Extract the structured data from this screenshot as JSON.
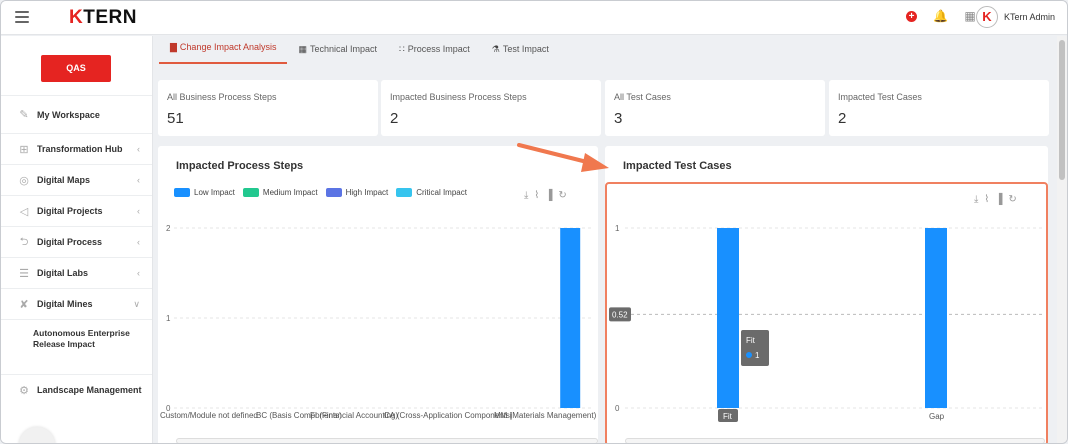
{
  "app": {
    "logo_k": "K",
    "logo_rest": "TERN",
    "user_name": "KTern Admin",
    "avatar_letter": "K"
  },
  "env": {
    "badge": "QAS"
  },
  "sidebar": {
    "items": [
      {
        "label": "My Workspace",
        "icon": "workspace-icon",
        "glyph": "✎",
        "has_chevron": false
      },
      {
        "label": "Transformation Hub",
        "icon": "grid-icon",
        "glyph": "⊞",
        "has_chevron": true
      },
      {
        "label": "Digital Maps",
        "icon": "map-icon",
        "glyph": "◎",
        "has_chevron": true
      },
      {
        "label": "Digital Projects",
        "icon": "projects-icon",
        "glyph": "◁",
        "has_chevron": true
      },
      {
        "label": "Digital Process",
        "icon": "process-icon",
        "glyph": "⮌",
        "has_chevron": true
      },
      {
        "label": "Digital Labs",
        "icon": "labs-icon",
        "glyph": "☰",
        "has_chevron": true
      },
      {
        "label": "Digital Mines",
        "icon": "mines-icon",
        "glyph": "✘",
        "has_chevron": true,
        "expanded": true
      }
    ],
    "sub_item": "Autonomous Enterprise Release Impact",
    "landscape": "Landscape Management"
  },
  "tabs": [
    {
      "label": "Change Impact Analysis",
      "icon": "chart-icon",
      "glyph": "▇",
      "active": true
    },
    {
      "label": "Technical Impact",
      "icon": "server-icon",
      "glyph": "▦",
      "active": false
    },
    {
      "label": "Process Impact",
      "icon": "process-flow-icon",
      "glyph": "∷",
      "active": false
    },
    {
      "label": "Test Impact",
      "icon": "flask-icon",
      "glyph": "⚗",
      "active": false
    }
  ],
  "cards": [
    {
      "label": "All Business Process Steps",
      "value": "51"
    },
    {
      "label": "Impacted Business Process Steps",
      "value": "2"
    },
    {
      "label": "All Test Cases",
      "value": "3"
    },
    {
      "label": "Impacted Test Cases",
      "value": "2"
    }
  ],
  "colors": {
    "accent": "#e52421",
    "bar": "#1890ff",
    "medium": "#22c88f",
    "high": "#5b74e4",
    "critical": "#36c4ee",
    "highlight": "#f08060",
    "arrow": "#f0784e"
  },
  "chart_data": [
    {
      "type": "bar",
      "title": "Impacted Process Steps",
      "legend": [
        "Low Impact",
        "Medium Impact",
        "High Impact",
        "Critical Impact"
      ],
      "legend_colors": [
        "#1890ff",
        "#22c88f",
        "#5b74e4",
        "#36c4ee"
      ],
      "categories": [
        "Custom/Module not defined",
        "BC (Basis Components)",
        "FI (Financial Accounting)",
        "CA (Cross-Application Components)",
        "MM (Materials Management)"
      ],
      "series": [
        {
          "name": "Low Impact",
          "values": [
            0,
            0,
            0,
            0,
            2
          ]
        }
      ],
      "yticks": [
        0,
        1,
        2
      ],
      "ylim": [
        0,
        2
      ]
    },
    {
      "type": "bar",
      "title": "Impacted Test Cases",
      "categories": [
        "Fit",
        "Gap"
      ],
      "series": [
        {
          "name": "Fit",
          "values": [
            1,
            1
          ]
        }
      ],
      "yticks": [
        0,
        1
      ],
      "ylim": [
        0,
        1
      ],
      "crosshair_value": "0.52",
      "tooltip": {
        "title": "Fit",
        "value": "1"
      }
    }
  ]
}
